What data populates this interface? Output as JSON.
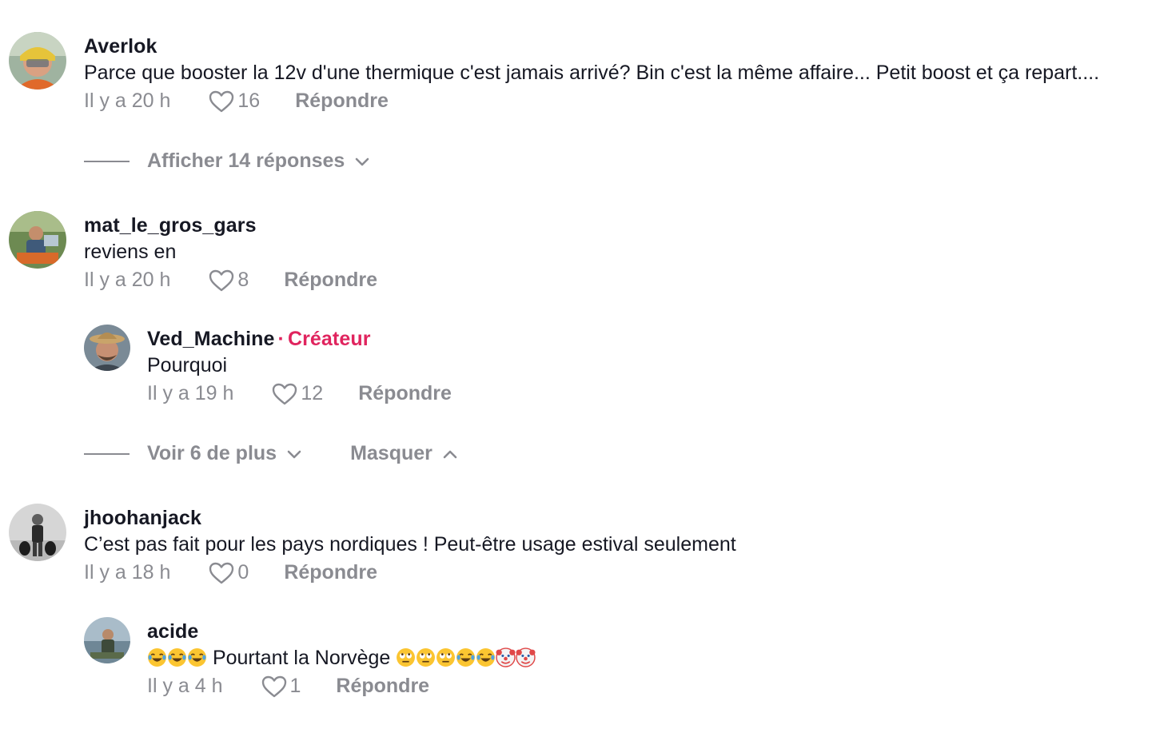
{
  "comments": [
    {
      "username": "Averlok",
      "text": "Parce que booster la 12v d'une thermique c'est jamais arrivé? Bin c'est la même affaire... Petit boost et ça repart....",
      "time": "Il y a 20 h",
      "likes": "16",
      "reply_label": "Répondre",
      "view_replies": "Afficher 14 réponses"
    },
    {
      "username": "mat_le_gros_gars",
      "text": "reviens en",
      "time": "Il y a 20 h",
      "likes": "8",
      "reply_label": "Répondre",
      "replies": [
        {
          "username": "Ved_Machine",
          "badge": "Créateur",
          "text": "Pourquoi",
          "time": "Il y a 19 h",
          "likes": "12",
          "reply_label": "Répondre"
        }
      ],
      "view_more": "Voir 6 de plus",
      "hide": "Masquer"
    },
    {
      "username": "jhoohanjack",
      "text": "C’est pas fait pour les pays nordiques ! Peut-être usage estival seulement",
      "time": "Il y a 18 h",
      "likes": "0",
      "reply_label": "Répondre",
      "replies": [
        {
          "username": "acide",
          "text_prefix": "😂😂😂",
          "text": "Pourtant la Norvège",
          "text_suffix": "🙄🙄🙄😂😂🤡🤡",
          "time": "Il y a 4 h",
          "likes": "1",
          "reply_label": "Répondre"
        }
      ]
    }
  ],
  "colors": {
    "text": "#161823",
    "meta": "#8a8b91",
    "creator": "#e0245e"
  },
  "icons": {
    "like": "heart-outline-icon",
    "expand": "chevron-down-icon",
    "collapse": "chevron-up-icon"
  }
}
